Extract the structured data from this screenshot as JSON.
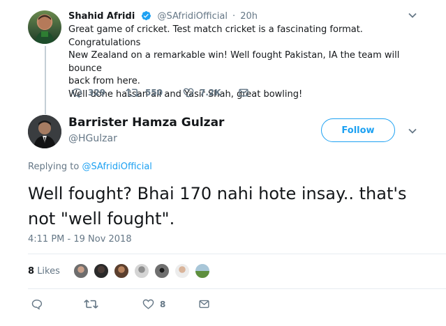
{
  "parent_tweet": {
    "author_name": "Shahid Afridi",
    "author_handle": "@SAfridiOfficial",
    "time": "20h",
    "separator": "·",
    "text_lines": [
      "Great game of cricket. Test match cricket is a fascinating format. Congratulations",
      "New Zealand on a remarkable win! Well fought Pakistan, IA the team will bounce",
      "back from here.",
      "Well done hassan ali and Yasir Shah, great bowling!"
    ],
    "actions": {
      "replies": "329",
      "retweets": "550",
      "likes": "7.2K"
    }
  },
  "reply_tweet": {
    "author_name": "Barrister Hamza Gulzar",
    "author_handle": "@HGulzar",
    "follow_label": "Follow",
    "replying_prefix": "Replying to ",
    "replying_to": "@SAfridiOfficial",
    "text_lines": [
      "Well fought? Bhai 170 nahi hote insay.. that's",
      "not \"well fought\"."
    ],
    "timestamp": "4:11 PM - 19 Nov 2018",
    "likes_count": "8",
    "likes_label": "Likes",
    "actions": {
      "likes": "8"
    }
  },
  "icons": [
    "verified-badge-icon",
    "chevron-down-icon",
    "reply-icon",
    "retweet-icon",
    "heart-icon",
    "envelope-icon"
  ],
  "colors": {
    "brand_blue": "#1da1f2",
    "secondary_text": "#657786",
    "primary_text": "#14171a",
    "divider": "#e6ecf0",
    "thread_line": "#c4cfd6"
  }
}
